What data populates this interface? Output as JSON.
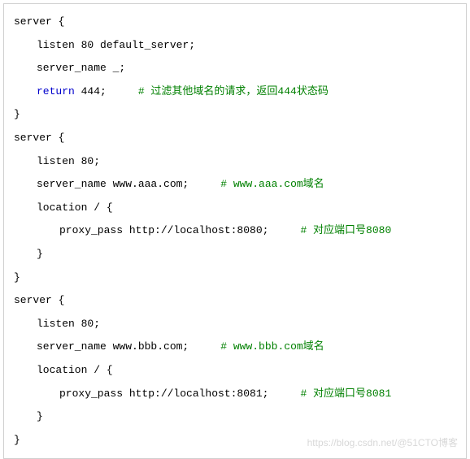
{
  "code": {
    "l1": "server {",
    "l2": "listen 80 default_server;",
    "l3": "server_name _;",
    "l4a": "return",
    "l4b": " 444;     ",
    "l4c": "# 过滤其他域名的请求，返回444状态码",
    "l5": "}",
    "l6": "server {",
    "l7": "listen 80;",
    "l8a": "server_name www.aaa.com;     ",
    "l8b": "# www.aaa.com域名",
    "l9": "location / {",
    "l10a": "proxy_pass http://localhost:8080;     ",
    "l10b": "# 对应端口号8080",
    "l11": "}",
    "l12": "}",
    "l13": "server {",
    "l14": "listen 80;",
    "l15a": "server_name www.bbb.com;     ",
    "l15b": "# www.bbb.com域名",
    "l16": "location / {",
    "l17a": "proxy_pass http://localhost:8081;     ",
    "l17b": "# 对应端口号8081",
    "l18": "}",
    "l19": "}"
  },
  "watermark": "https://blog.csdn.net/@51CTO博客"
}
